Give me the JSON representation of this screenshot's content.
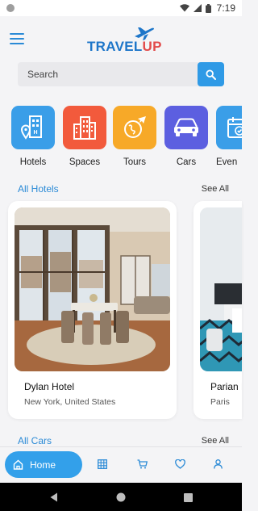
{
  "status_bar": {
    "time": "7:19"
  },
  "app": {
    "logo_part1": "TRAVEL",
    "logo_part2": "UP",
    "brand_blue": "#1e76c9",
    "brand_red": "#e24a4a",
    "accent": "#2f9ae6"
  },
  "search": {
    "placeholder": "Search"
  },
  "categories": [
    {
      "label": "Hotels",
      "icon": "hotel-location-icon",
      "color": "#3a9ee8"
    },
    {
      "label": "Spaces",
      "icon": "building-icon",
      "color": "#f25a3c"
    },
    {
      "label": "Tours",
      "icon": "globe-plane-icon",
      "color": "#f7a928"
    },
    {
      "label": "Cars",
      "icon": "car-icon",
      "color": "#5c5fe0"
    },
    {
      "label": "Even",
      "icon": "calendar-icon",
      "color": "#3a9ee8"
    }
  ],
  "hotels_section": {
    "title": "All Hotels",
    "see_all": "See All"
  },
  "hotels": [
    {
      "name": "Dylan Hotel",
      "location": "New York, United States"
    },
    {
      "name": "Parian H",
      "location": "Paris"
    }
  ],
  "cars_section": {
    "title": "All Cars",
    "see_all": "See All"
  },
  "bottom_nav": {
    "home_label": "Home",
    "items": [
      "grid-icon",
      "cart-icon",
      "heart-icon",
      "user-icon"
    ]
  }
}
